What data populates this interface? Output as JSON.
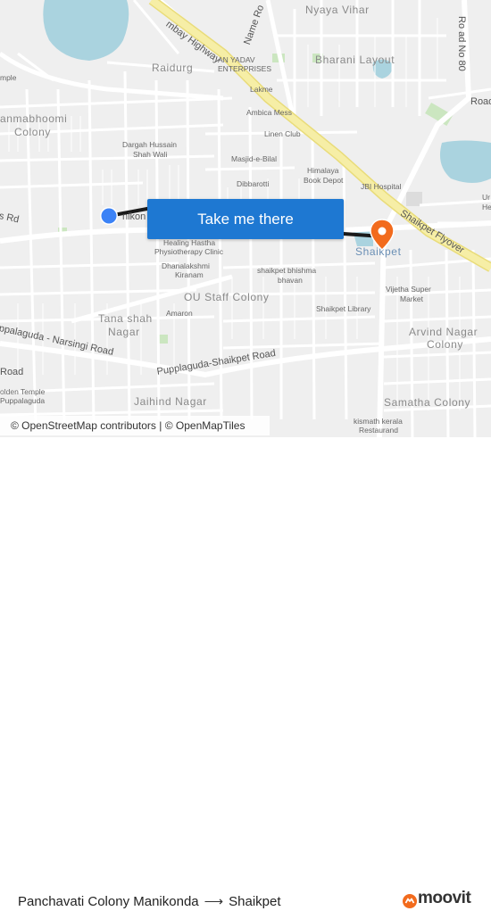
{
  "map": {
    "areas": {
      "raidurg": "Raidurg",
      "nyaya_vihar": "Nyaya Vihar",
      "bharani_layout": "Bharani Layout",
      "janmabhoomi_1": "anmabhoomi",
      "janmabhoomi_2": "Colony",
      "ou_staff_colony": "OU Staff Colony",
      "tana_shah_1": "Tana shah",
      "tana_shah_2": "Nagar",
      "arvind_nagar_1": "Arvind Nagar",
      "arvind_nagar_2": "Colony",
      "samatha_colony": "Samatha Colony",
      "jaihind_nagar": "Jaihind Nagar",
      "shaikpet": "Shaikpet"
    },
    "roads": {
      "bombay_highway": "mbay Highway",
      "name_road": "Name Ro",
      "shaikpet_flyover": "Shaikpet Flyover",
      "puppalaguda_narsingi": "ppalaguda - Narsingi Road",
      "pupplaguda_shaikpet": "Pupplaguda-Shaikpet Road",
      "road_no_80": "Ro ad No 80",
      "rd_left": "s Rd",
      "road_left_bottom": "Road",
      "road_right": "Road",
      "manikonda_partial": "nikon"
    },
    "pois": {
      "an_yadav_1": "AN YADAV",
      "an_yadav_2": "ENTERPRISES",
      "lakme": "Lakme",
      "ambica_mess": "Ambica Mess",
      "linen_club": "Linen Club",
      "dargah_1": "Dargah Hussain",
      "dargah_2": "Shah Wali",
      "masjid": "Masjid-e-Bilal",
      "himalaya_1": "Himalaya",
      "himalaya_2": "Book Depot",
      "dibbarotti": "Dibbarotti",
      "jbi_hospital": "JBI Hospital",
      "healing_1": "Healing Hastha",
      "healing_2": "Physiotherapy Clinic",
      "dhanalakshmi_1": "Dhanalakshmi",
      "dhanalakshmi_2": "Kiranam",
      "bhishma_1": "shaikpet bhishma",
      "bhishma_2": "bhavan",
      "amaron": "Amaron",
      "shaikpet_library": "Shaikpet Library",
      "vijetha_1": "Vijetha Super",
      "vijetha_2": "Market",
      "golden_temple_1": "olden Temple",
      "golden_temple_2": "Puppalaguda",
      "kismath_1": "kismath kerala",
      "kismath_2": "Restaurand",
      "temple_partial": "mple",
      "right_partial_1": "Ur",
      "right_partial_2": "He"
    },
    "button_label": "Take me there",
    "attribution": "© OpenStreetMap contributors | © OpenMapTiles",
    "colors": {
      "route": "#1a1a1a",
      "origin": "#3b82f6",
      "destination": "#f26b1d",
      "water": "#aad3df",
      "park": "#cbe6c0",
      "highway": "#f6eea6",
      "button": "#1e78d2"
    }
  },
  "footer": {
    "origin": "Panchavati Colony Manikonda",
    "destination": "Shaikpet",
    "brand": "moovit"
  }
}
